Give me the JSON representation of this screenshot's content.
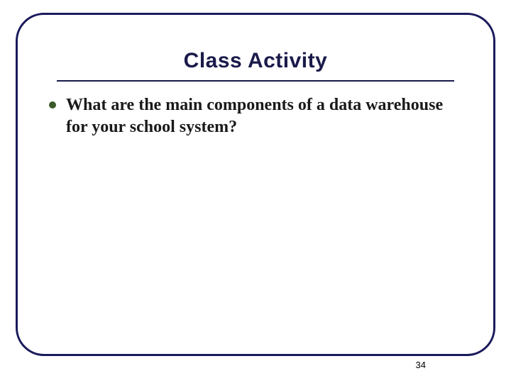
{
  "slide": {
    "title": "Class Activity",
    "bullets": [
      {
        "text": "What are the main components of a data warehouse for your school system?"
      }
    ],
    "page_number": "34"
  }
}
